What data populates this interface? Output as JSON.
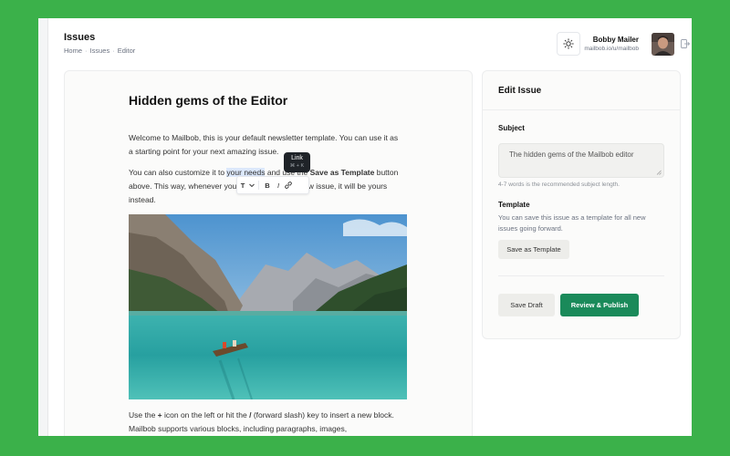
{
  "header": {
    "title": "Issues",
    "breadcrumb": [
      "Home",
      "Issues",
      "Editor"
    ],
    "user_name": "Bobby Mailer",
    "user_email": "mailbob.io/u/mailbob"
  },
  "editor": {
    "heading": "Hidden gems of the Editor",
    "p1": "Welcome to Mailbob, this is your default newsletter template. You can use it as a starting point for your next amazing issue.",
    "p2_a": "You can also customize it to ",
    "p2_highlight": "your needs",
    "p2_b": " and use the ",
    "p2_bold": "Save as Template",
    "p2_c": " button above. This way, whenever you choose to write a new issue, it will be yours instead.",
    "p3_a": "Use the ",
    "p3_plus": "+",
    "p3_b": " icon on the left or hit the ",
    "p3_slash": "/",
    "p3_c": " (forward slash) key to insert a new block. Mailbob supports various blocks, including paragraphs, images,",
    "tooltip_title": "Link",
    "tooltip_shortcut": "⌘ + K",
    "format_bar": [
      "T",
      "B",
      "I"
    ]
  },
  "sidebar": {
    "title": "Edit Issue",
    "subject_label": "Subject",
    "subject_value": "The hidden gems of the Mailbob editor",
    "subject_hint": "4-7 words is the recommended subject length.",
    "template_label": "Template",
    "template_desc": "You can save this issue as a template for all new issues going forward.",
    "save_template_label": "Save as Template",
    "save_draft_label": "Save Draft",
    "publish_label": "Review & Publish"
  },
  "colors": {
    "background": "#3bb14a",
    "primary": "#1a8a5a"
  }
}
